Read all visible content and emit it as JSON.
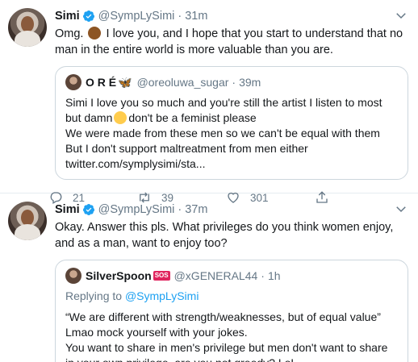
{
  "tweets": [
    {
      "name": "Simi",
      "handle": "@SympLySimi",
      "time": "31m",
      "text_before": "Omg.",
      "text_after": "I love you, and I hope that you start to understand that no man in the entire world is more valuable than you are.",
      "emoji": "face-palm-emoji",
      "quote": {
        "name": "O R É",
        "name_emoji": "🦋",
        "handle": "@oreoluwa_sugar",
        "time": "39m",
        "lines": [
          "Simi I love you so much and you're still the artist I listen to most but damn",
          "don't be a feminist please",
          "We were made from these men so we can't be equal with them",
          "But I don't support maltreatment from men either",
          "twitter.com/symplysimi/sta..."
        ]
      },
      "actions": {
        "replies": "21",
        "retweets": "39",
        "likes": "301"
      }
    },
    {
      "name": "Simi",
      "handle": "@SympLySimi",
      "time": "37m",
      "text": "Okay. Answer this pls. What privileges do you think women enjoy, and as a man, want to enjoy too?",
      "quote": {
        "name": "SilverSpoon",
        "badge": "SOS",
        "handle": "@xGENERAL44",
        "time": "1h",
        "replying_prefix": "Replying to",
        "replying_to": "@SympLySimi",
        "lines": [
          "“We are different with strength/weaknesses, but of equal value” Lmao mock yourself with your jokes.",
          "You want to share in men's privilege but men don't want to share in your own privilege, are you not greedy? LoL"
        ]
      }
    }
  ],
  "separator_dot": "·",
  "colors": {
    "accent": "#1da1f2",
    "muted": "#657786",
    "border": "#e6ecf0"
  }
}
